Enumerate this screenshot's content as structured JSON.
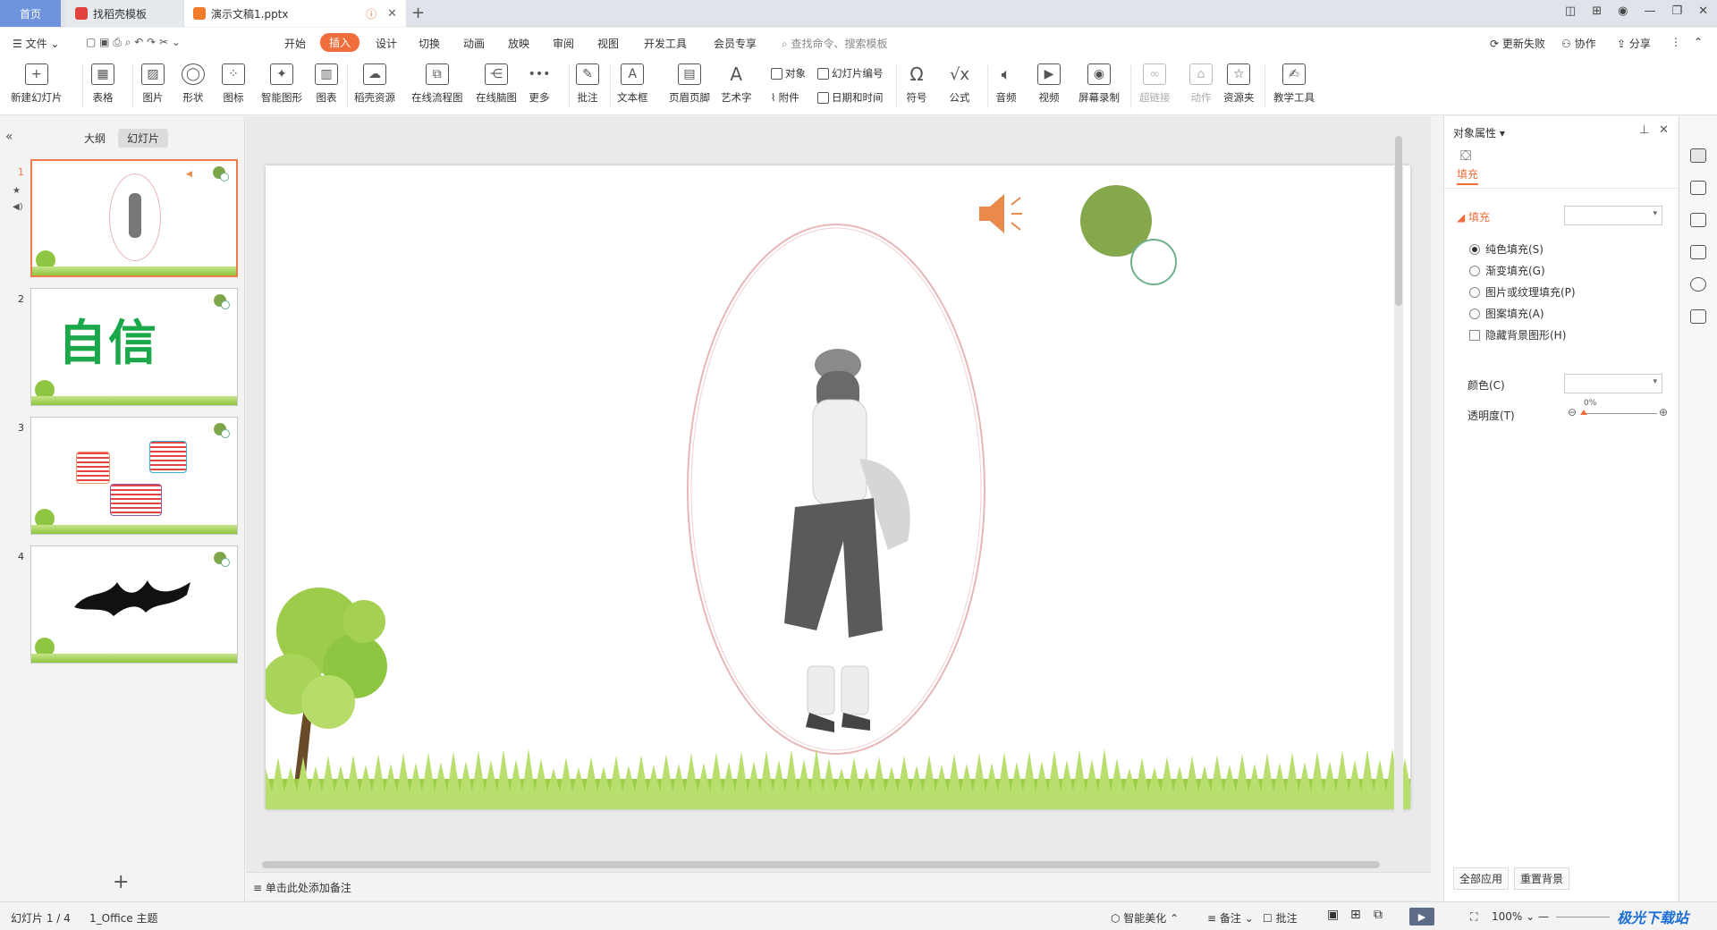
{
  "tabs": {
    "home": "首页",
    "template": "找稻壳模板",
    "doc": "演示文稿1.pptx"
  },
  "menu": {
    "file": "文件",
    "items": [
      "开始",
      "插入",
      "设计",
      "切换",
      "动画",
      "放映",
      "审阅",
      "视图",
      "开发工具",
      "会员专享"
    ],
    "active": "插入",
    "search_placeholder": "查找命令、搜索模板",
    "update": "更新失败",
    "collab": "协作",
    "share": "分享"
  },
  "ribbon": {
    "new_slide": "新建幻灯片",
    "table": "表格",
    "picture": "图片",
    "shape": "形状",
    "icon": "图标",
    "smart_shape": "智能图形",
    "chart": "图表",
    "resource": "稻壳资源",
    "flowchart": "在线流程图",
    "mindmap": "在线脑图",
    "more": "更多",
    "comment": "批注",
    "textbox": "文本框",
    "header_footer": "页眉页脚",
    "wordart": "艺术字",
    "object": "对象",
    "slide_number": "幻灯片编号",
    "attachment": "附件",
    "datetime": "日期和时间",
    "symbol": "符号",
    "formula": "公式",
    "audio": "音频",
    "video": "视频",
    "screen_record": "屏幕录制",
    "hyperlink": "超链接",
    "action": "动作",
    "resource_folder": "资源夹",
    "teaching": "教学工具"
  },
  "left_panel": {
    "outline": "大纲",
    "slides": "幻灯片",
    "slide_numbers": [
      "1",
      "2",
      "3",
      "4"
    ],
    "slide2_text": "自信"
  },
  "notes_placeholder": "单击此处添加备注",
  "right_panel": {
    "title": "对象属性",
    "fill_tab": "填充",
    "fill_section": "填充",
    "options": [
      "纯色填充(S)",
      "渐变填充(G)",
      "图片或纹理填充(P)",
      "图案填充(A)"
    ],
    "hide_bg": "隐藏背景图形(H)",
    "color_label": "颜色(C)",
    "transparency_label": "透明度(T)",
    "transparency_value": "0%",
    "apply_all": "全部应用",
    "reset_bg": "重置背景"
  },
  "status": {
    "slide_info": "幻灯片 1 / 4",
    "theme": "1_Office 主题",
    "beautify": "智能美化",
    "notes": "备注",
    "comments": "批注",
    "zoom": "100%",
    "watermark": "极光下载站"
  },
  "colors": {
    "accent": "#f06e3c",
    "tab_home": "#6e93dc",
    "green_circle": "#86a84d",
    "ring": "#6fb08b",
    "speaker": "#ea8a4a"
  }
}
